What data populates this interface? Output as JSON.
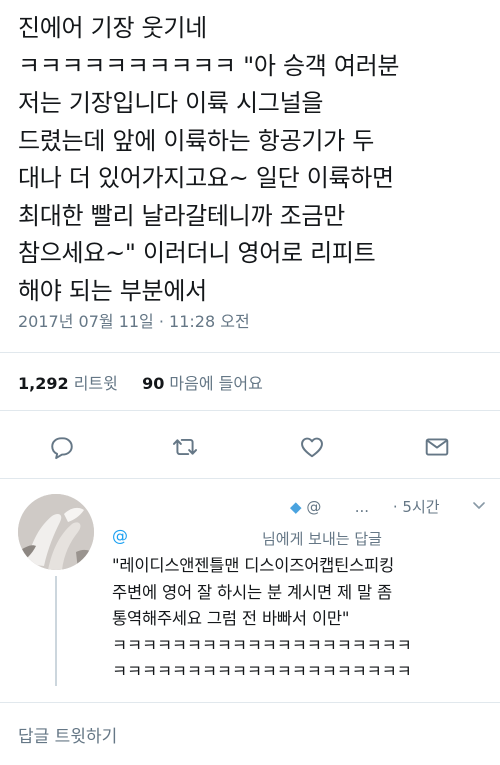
{
  "tweet": {
    "text_lines": [
      "진에어 기장          웃기네",
      "ㅋㅋㅋㅋㅋㅋㅋㅋㅋㅋ \"아 승객 여러분",
      "저는 기장입니다 이륙 시그널을",
      "드렸는데 앞에 이륙하는 항공기가 두",
      "대나 더 있어가지고요~ 일단 이륙하면",
      "최대한 빨리 날라갈테니까 조금만",
      "참으세요~\" 이러더니 영어로 리피트",
      "해야 되는 부분에서"
    ],
    "timestamp": "2017년 07월 11일 · 11:28 오전",
    "retweets": {
      "count": "1,292",
      "label": "리트윗"
    },
    "likes": {
      "count": "90",
      "label": "마음에 들어요"
    }
  },
  "actions": {
    "reply_icon": "speech-bubble-icon",
    "retweet_icon": "retweet-arrows-icon",
    "like_icon": "heart-icon",
    "dm_icon": "envelope-icon"
  },
  "reply": {
    "header_prefix": "@",
    "header_ellipsis": "...",
    "header_time": "· 5시간",
    "handle_at": "@",
    "replying_to": "님에게 보내는 답글",
    "text_lines": [
      "\"레이디스앤젠틀맨 디스이즈어캡틴스피킹",
      "주변에 영어 잘 하시는 분 계시면 제 말 좀",
      "통역해주세요 그럼 전 바빠서 이만\"",
      "ㅋㅋㅋㅋㅋㅋㅋㅋㅋㅋㅋㅋㅋㅋㅋㅋㅋㅋㅋㅋ",
      "ㅋㅋㅋㅋㅋㅋㅋㅋㅋㅋㅋㅋㅋㅋㅋㅋㅋㅋㅋㅋ"
    ]
  },
  "compose": {
    "placeholder": "답글 트윗하기"
  },
  "colors": {
    "accent": "#1da1f2",
    "muted": "#657786",
    "text": "#14171a",
    "divider": "#e1e8ed",
    "verified_badge": "#4aa3df"
  }
}
